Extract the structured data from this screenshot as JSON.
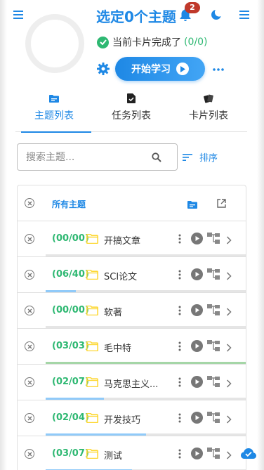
{
  "header": {
    "title": "选定0个主题",
    "notification_count": "2",
    "status_text": "当前卡片完成了",
    "status_count": "(0/0)",
    "start_label": "开始学习",
    "icons": [
      "menu-icon",
      "bell-icon",
      "moon-icon",
      "gear-icon",
      "play-icon",
      "more-icon",
      "cloud-done-icon"
    ]
  },
  "tabs": [
    {
      "label": "主题列表",
      "icon": "folder-icon",
      "active": true
    },
    {
      "label": "任务列表",
      "icon": "task-icon",
      "active": false
    },
    {
      "label": "卡片列表",
      "icon": "cards-icon",
      "active": false
    }
  ],
  "search": {
    "placeholder": "搜索主题...",
    "value": "",
    "sort_label": "排序"
  },
  "list": {
    "all_label": "所有主题",
    "rows": [
      {
        "count": "(00/00)",
        "name": "开搞文章",
        "progress": 0,
        "bar_color": "#90caf9"
      },
      {
        "count": "(06/40)",
        "name": "SCI论文",
        "progress": 0.15,
        "bar_color": "#90caf9"
      },
      {
        "count": "(00/00)",
        "name": "软著",
        "progress": 0,
        "bar_color": "#90caf9"
      },
      {
        "count": "(03/03)",
        "name": "毛中特",
        "progress": 1.0,
        "bar_color": "#a5d6a7"
      },
      {
        "count": "(02/07)",
        "name": "马克思主义...",
        "progress": 0.29,
        "bar_color": "#90caf9"
      },
      {
        "count": "(02/04)",
        "name": "开发技巧",
        "progress": 0.5,
        "bar_color": "#90caf9"
      },
      {
        "count": "(03/07)",
        "name": "测试",
        "progress": 0.43,
        "bar_color": "#90caf9"
      }
    ]
  },
  "colors": {
    "accent": "#1e88e5",
    "success": "#2eb872",
    "badge": "#c0392b",
    "folder": "#fdd835"
  }
}
